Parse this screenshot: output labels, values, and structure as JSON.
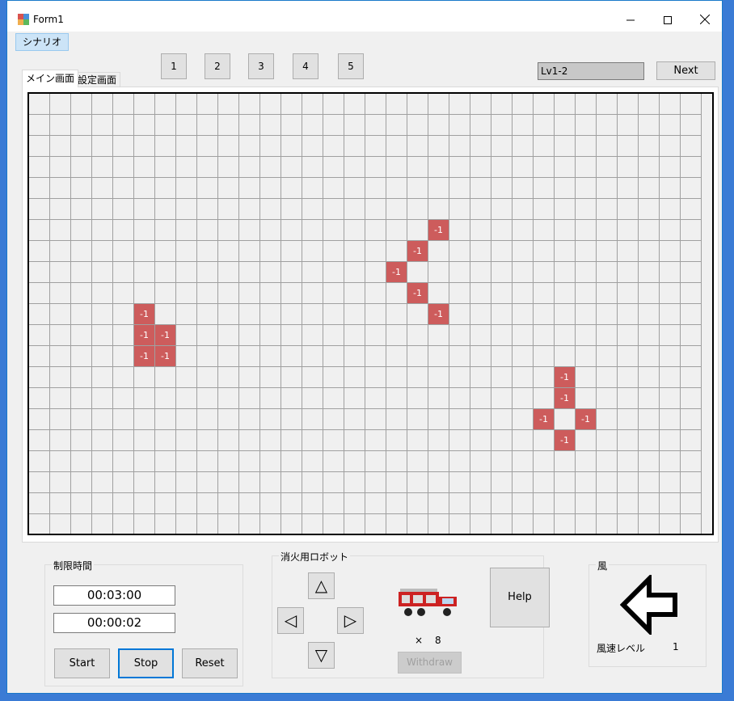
{
  "window": {
    "title": "Form1"
  },
  "menu": {
    "scenario": "シナリオ"
  },
  "level_buttons": [
    "1",
    "2",
    "3",
    "4",
    "5"
  ],
  "level_display": "Lv1-2",
  "next_label": "Next",
  "tabs": {
    "main": "メイン画面",
    "settings": "設定画面"
  },
  "grid": {
    "cols": 32,
    "rows": 21,
    "fire_cells": [
      {
        "row": 6,
        "col": 19,
        "value": "-1"
      },
      {
        "row": 7,
        "col": 18,
        "value": "-1"
      },
      {
        "row": 8,
        "col": 17,
        "value": "-1"
      },
      {
        "row": 9,
        "col": 18,
        "value": "-1"
      },
      {
        "row": 10,
        "col": 19,
        "value": "-1"
      },
      {
        "row": 10,
        "col": 5,
        "value": "-1"
      },
      {
        "row": 11,
        "col": 5,
        "value": "-1"
      },
      {
        "row": 11,
        "col": 6,
        "value": "-1"
      },
      {
        "row": 12,
        "col": 5,
        "value": "-1"
      },
      {
        "row": 12,
        "col": 6,
        "value": "-1"
      },
      {
        "row": 13,
        "col": 25,
        "value": "-1"
      },
      {
        "row": 14,
        "col": 25,
        "value": "-1"
      },
      {
        "row": 15,
        "col": 24,
        "value": "-1"
      },
      {
        "row": 15,
        "col": 26,
        "value": "-1"
      },
      {
        "row": 16,
        "col": 25,
        "value": "-1"
      }
    ]
  },
  "time_limit": {
    "label": "制限時間",
    "limit": "00:03:00",
    "elapsed": "00:00:02",
    "start": "Start",
    "stop": "Stop",
    "reset": "Reset"
  },
  "robot": {
    "label": "消火用ロボット",
    "up": "△",
    "down": "▽",
    "left": "◁",
    "right": "▷",
    "count_prefix": "×",
    "count": "8",
    "help": "Help",
    "withdraw": "Withdraw"
  },
  "wind": {
    "label": "風",
    "direction": "left-arrow",
    "speed_label": "風速レベル",
    "speed": "1"
  }
}
